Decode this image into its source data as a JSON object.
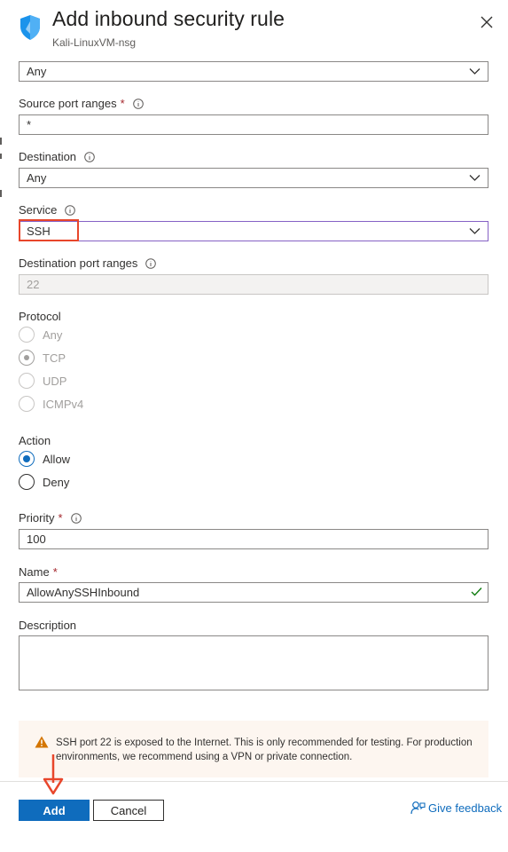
{
  "header": {
    "title": "Add inbound security rule",
    "subtitle": "Kali-LinuxVM-nsg"
  },
  "source": {
    "value": "Any"
  },
  "source_port_ranges": {
    "label": "Source port ranges",
    "value": "*"
  },
  "destination": {
    "label": "Destination",
    "value": "Any"
  },
  "service": {
    "label": "Service",
    "value": "SSH"
  },
  "destination_port_ranges": {
    "label": "Destination port ranges",
    "value": "22"
  },
  "protocol": {
    "label": "Protocol",
    "options": [
      "Any",
      "TCP",
      "UDP",
      "ICMPv4"
    ],
    "selected": "TCP"
  },
  "action": {
    "label": "Action",
    "options": [
      "Allow",
      "Deny"
    ],
    "selected": "Allow"
  },
  "priority": {
    "label": "Priority",
    "value": "100"
  },
  "name": {
    "label": "Name",
    "value": "AllowAnySSHInbound"
  },
  "description": {
    "label": "Description",
    "value": ""
  },
  "warning": {
    "text": "SSH port 22 is exposed to the Internet. This is only recommended for testing. For production environments, we recommend using a VPN or private connection."
  },
  "footer": {
    "add_label": "Add",
    "cancel_label": "Cancel",
    "feedback_label": "Give feedback"
  },
  "colors": {
    "accent": "#0f6cbd",
    "annotation": "#e8462b",
    "required": "#a4262c",
    "success": "#107c10"
  }
}
